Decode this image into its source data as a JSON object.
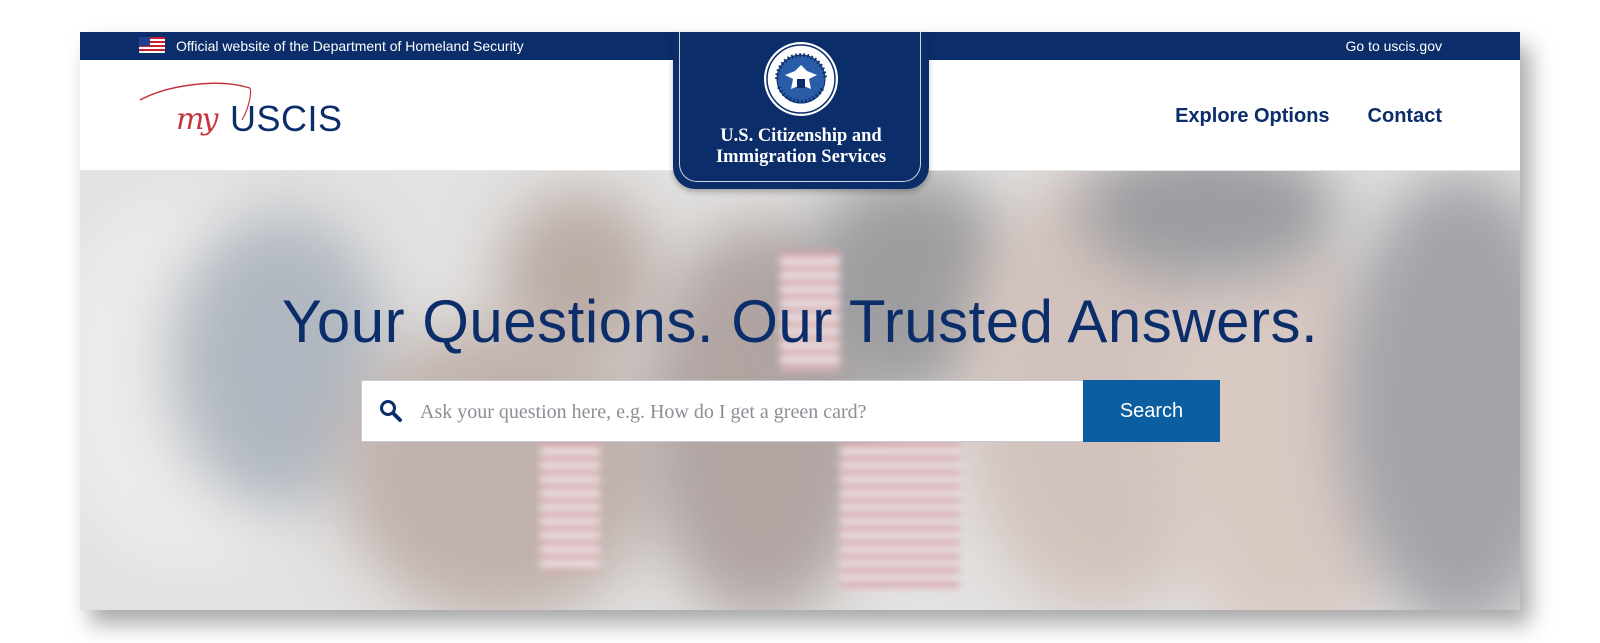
{
  "topbar": {
    "official_text": "Official website of the Department of Homeland Security",
    "go_link": "Go to uscis.gov"
  },
  "header": {
    "logo_my": "my",
    "logo_uscis": "USCIS",
    "nav": [
      "Explore Options",
      "Contact"
    ]
  },
  "emblem": {
    "agency_line1": "U.S. Citizenship and",
    "agency_line2": "Immigration Services",
    "seal_icon": "dhs-seal-icon"
  },
  "hero": {
    "headline": "Your Questions. Our Trusted Answers.",
    "search_placeholder": "Ask your question here, e.g. How do I get a green card?",
    "search_value": "",
    "search_button": "Search"
  },
  "colors": {
    "navy": "#0b2e6b",
    "search_button": "#0b5fa0",
    "logo_red": "#c4353d"
  }
}
